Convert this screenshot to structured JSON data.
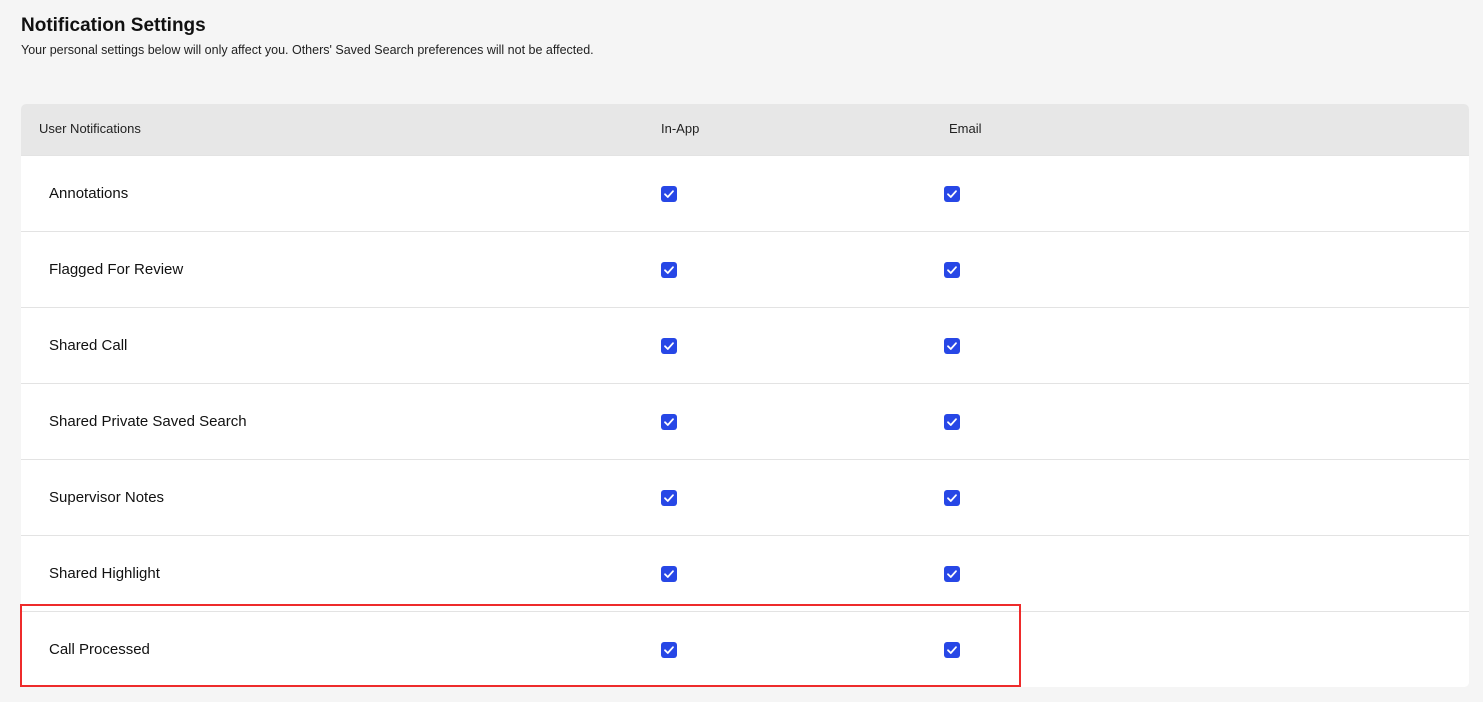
{
  "header": {
    "title": "Notification Settings",
    "subtitle": "Your personal settings below will only affect you. Others' Saved Search preferences will not be affected."
  },
  "table": {
    "columns": {
      "name": "User Notifications",
      "in_app": "In-App",
      "email": "Email"
    },
    "rows": [
      {
        "label": "Annotations",
        "in_app": true,
        "email": true
      },
      {
        "label": "Flagged For Review",
        "in_app": true,
        "email": true
      },
      {
        "label": "Shared Call",
        "in_app": true,
        "email": true
      },
      {
        "label": "Shared Private Saved Search",
        "in_app": true,
        "email": true
      },
      {
        "label": "Supervisor Notes",
        "in_app": true,
        "email": true
      },
      {
        "label": "Shared Highlight",
        "in_app": true,
        "email": true
      },
      {
        "label": "Call Processed",
        "in_app": true,
        "email": true
      }
    ]
  },
  "colors": {
    "checkbox_checked": "#2747e6",
    "highlight_border": "#ee2b2b",
    "header_bg": "#e7e7e7",
    "page_bg": "#f5f5f5"
  },
  "icons": {
    "checkbox": "check-icon"
  }
}
